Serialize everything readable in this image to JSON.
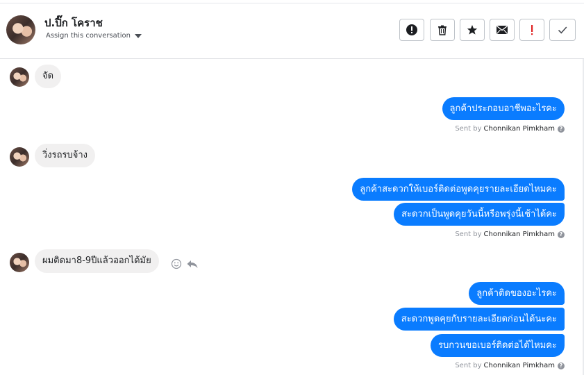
{
  "header": {
    "name": "ป.ปิ๊ก โคราช",
    "assign_label": "Assign this conversation",
    "icons": [
      "spam-icon",
      "trash-icon",
      "star-icon",
      "mail-icon",
      "flag-icon",
      "check-icon"
    ]
  },
  "colors": {
    "outgoing_bubble": "#0a7cff",
    "incoming_bubble": "#f1f0f0"
  },
  "messages": [
    {
      "direction": "in",
      "text": "จัด"
    },
    {
      "direction": "out",
      "text": "ลูกค้าประกอบอาชีพอะไรคะ"
    },
    {
      "direction": "in",
      "text": "วิ่งรถรบจ้าง"
    },
    {
      "direction": "out",
      "text": "ลูกค้าสะดวกให้เบอร์ติดต่อพูดคุยรายละเอียดไหมคะ"
    },
    {
      "direction": "out",
      "text": "สะดวกเป็นพูดคุยวันนี้หรือพรุ่งนี้เช้าได้คะ"
    },
    {
      "direction": "in",
      "text": "ผมติดมา8-9ปีแล้วออกได้มัย"
    },
    {
      "direction": "out",
      "text": "ลูกค้าติดของอะไรคะ"
    },
    {
      "direction": "out",
      "text": "สะดวกพูดคุยกับรายละเอียดก่อนได้นะคะ"
    },
    {
      "direction": "out",
      "text": "รบกวนขอเบอร์ติดต่อได้ไหมคะ"
    }
  ],
  "sent_by": {
    "prefix": "Sent by",
    "agent": "Chonnikan Pimkham",
    "help": "?"
  },
  "message_actions": [
    "emoji-icon",
    "reply-icon"
  ]
}
